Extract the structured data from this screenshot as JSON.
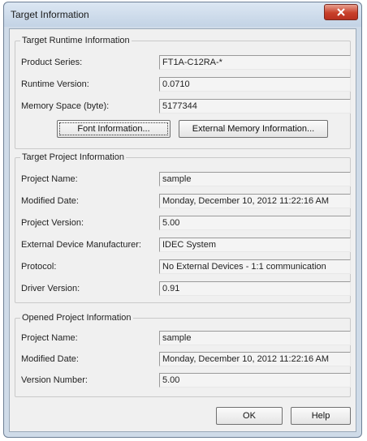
{
  "window": {
    "title": "Target Information"
  },
  "runtime": {
    "legend": "Target Runtime Information",
    "fields": [
      {
        "label": "Product Series:",
        "value": "FT1A-C12RA-*"
      },
      {
        "label": "Runtime Version:",
        "value": "0.0710"
      },
      {
        "label": "Memory Space (byte):",
        "value": "5177344"
      }
    ],
    "font_button": "Font Information...",
    "external_memory_button": "External Memory Information..."
  },
  "project": {
    "legend": "Target Project Information",
    "fields": [
      {
        "label": "Project Name:",
        "value": "sample"
      },
      {
        "label": "Modified Date:",
        "value": "Monday, December 10, 2012 11:22:16 AM"
      },
      {
        "label": "Project Version:",
        "value": "5.00"
      },
      {
        "label": "External Device Manufacturer:",
        "value": "IDEC System"
      },
      {
        "label": "Protocol:",
        "value": "No External Devices - 1:1 communication"
      },
      {
        "label": "Driver Version:",
        "value": "0.91"
      }
    ]
  },
  "opened": {
    "legend": "Opened Project Information",
    "fields": [
      {
        "label": "Project Name:",
        "value": "sample"
      },
      {
        "label": "Modified Date:",
        "value": "Monday, December 10, 2012 11:22:16 AM"
      },
      {
        "label": "Version Number:",
        "value": "5.00"
      }
    ]
  },
  "buttons": {
    "ok": "OK",
    "help": "Help"
  }
}
